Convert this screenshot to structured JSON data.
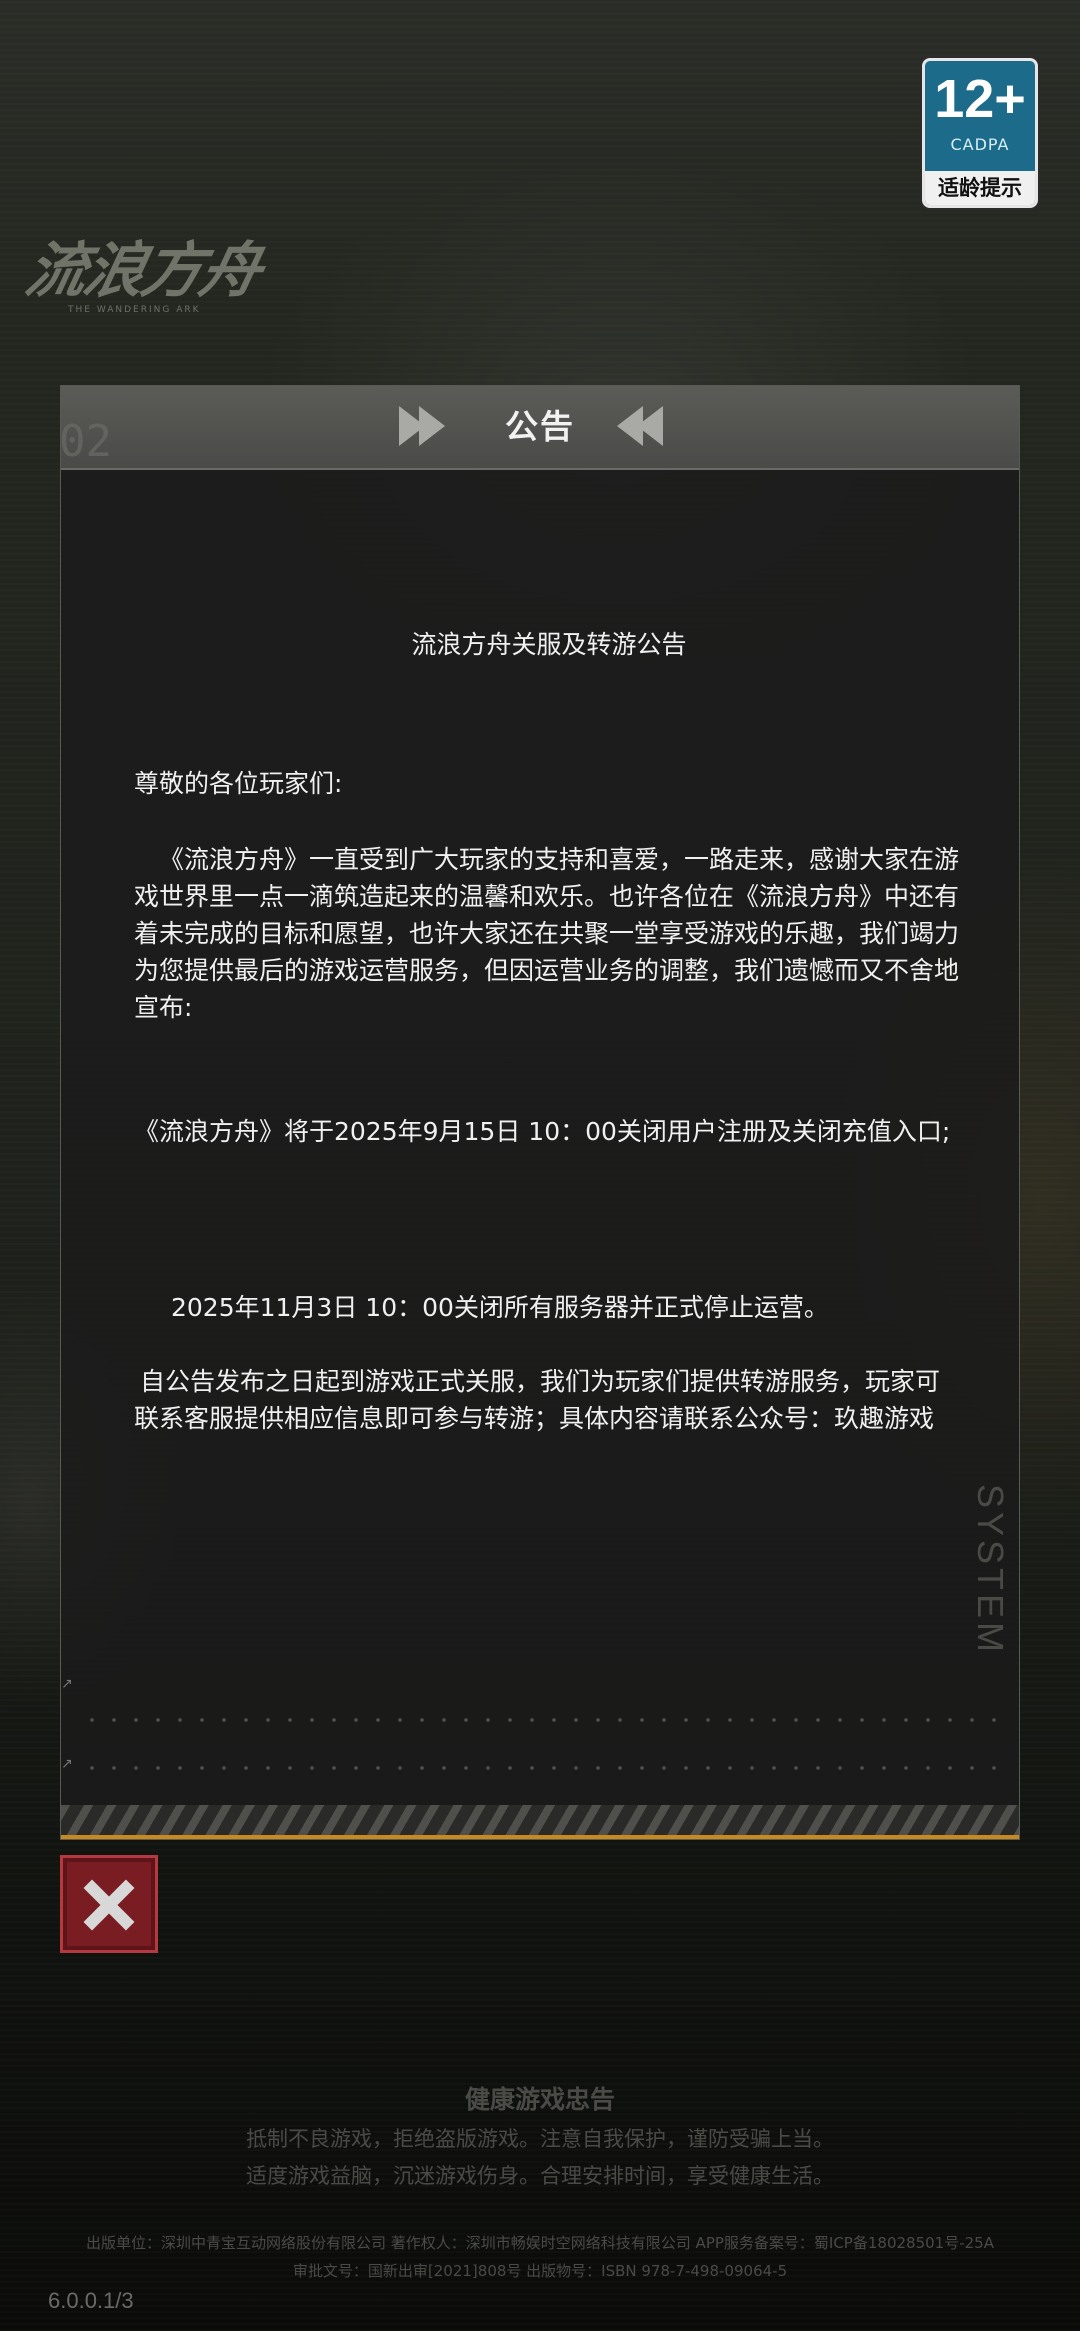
{
  "game": {
    "logo_text": "流浪方舟",
    "logo_sub": "THE WANDERING ARK"
  },
  "age_rating": {
    "number": "12+",
    "org": "CADPA",
    "tip": "适龄提示"
  },
  "dialog": {
    "title": "公告",
    "header_number": "02",
    "side_label": "SYSTEM",
    "heading": "流浪方舟关服及转游公告",
    "greeting": "尊敬的各位玩家们:",
    "paragraph1": "《流浪方舟》一直受到广大玩家的支持和喜爱，一路走来，感谢大家在游戏世界里一点一滴筑造起来的温馨和欢乐。也许各位在《流浪方舟》中还有着未完成的目标和愿望，也许大家还在共聚一堂享受游戏的乐趣，我们竭力为您提供最后的游戏运营服务，但因运营业务的调整，我们遗憾而又不舍地宣布:",
    "paragraph2": "《流浪方舟》将于2025年9月15日 10：00关闭用户注册及关闭充值入口;",
    "paragraph3": "2025年11月3日 10：00关闭所有服务器并正式停止运营。",
    "paragraph4": "自公告发布之日起到游戏正式关服，我们为玩家们提供转游服务，玩家可联系客服提供相应信息即可参与转游；具体内容请联系公众号：玖趣游戏"
  },
  "health_notice": {
    "title": "健康游戏忠告",
    "line1": "抵制不良游戏，拒绝盗版游戏。注意自我保护，谨防受骗上当。",
    "line2": "适度游戏益脑，沉迷游戏伤身。合理安排时间，享受健康生活。"
  },
  "publication": {
    "line1": "出版单位：深圳中青宝互动网络股份有限公司 著作权人：深圳市畅娱时空网络科技有限公司 APP服务备案号：蜀ICP备18028501号-25A",
    "line2": "审批文号：国新出审[2021]808号 出版物号：ISBN 978-7-498-09064-5"
  },
  "version": "6.0.0.1/3",
  "colors": {
    "accent_orange": "#c88a1e",
    "close_red": "#7a1d22",
    "badge_blue": "#1d6b8b"
  }
}
